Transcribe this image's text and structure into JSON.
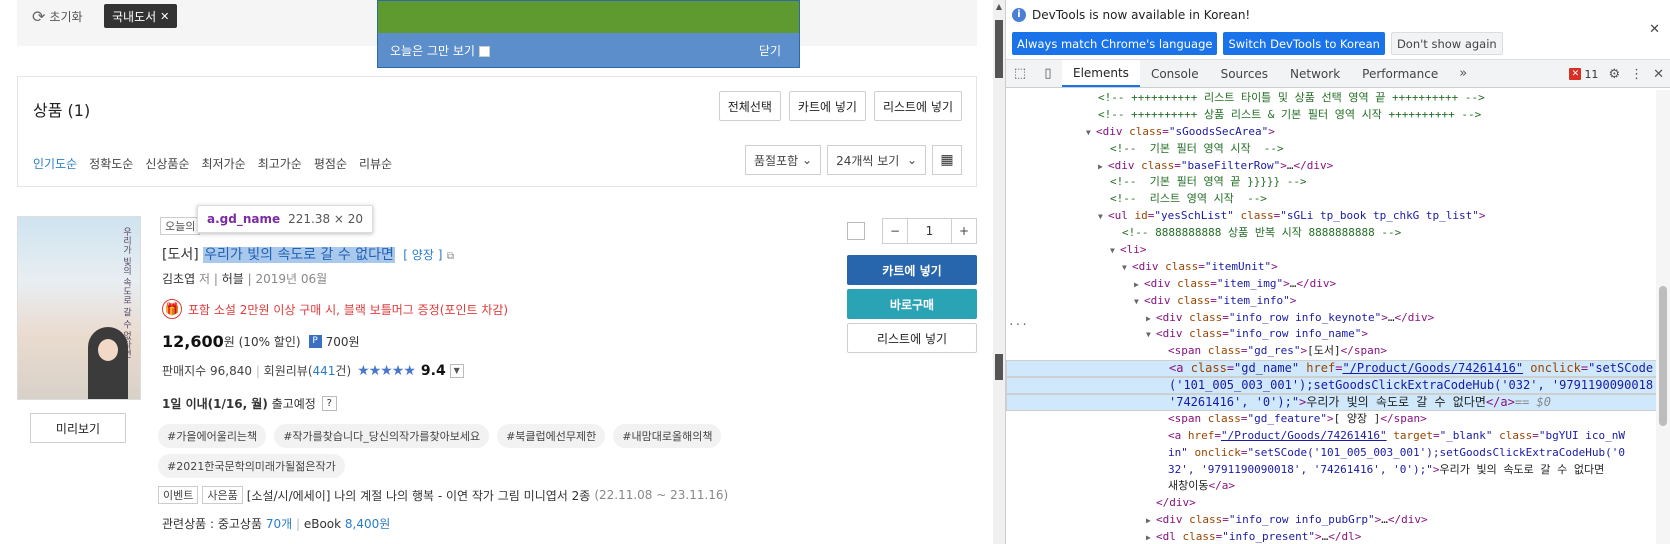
{
  "page": {
    "reset_label": "초기화",
    "filter_chip": "국내도서",
    "popup": {
      "dont_show_today": "오늘은 그만 보기",
      "close": "닫기"
    },
    "section_title": "상품 (1)",
    "top_buttons": [
      "전체선택",
      "카트에 넣기",
      "리스트에 넣기"
    ],
    "sorts": [
      "인기도순",
      "정확도순",
      "신상품순",
      "최저가순",
      "최고가순",
      "평점순",
      "리뷰순"
    ],
    "sort_active_index": 0,
    "filter_select": "품절포함",
    "perpage_select": "24개씩 보기",
    "tooltip": {
      "name": "a.gd_name",
      "dims": "221.38 × 20"
    },
    "keynote": "오늘의",
    "book": {
      "cover_text": "우리가 빛의 속도로 갈 수 없다면",
      "res": "[도서]",
      "title": "우리가 빛의 속도로 갈 수 없다면",
      "feature": "[ 양장 ]",
      "author": "김초엽",
      "author_suffix": "저",
      "publisher": "허블",
      "date": "2019년 06월",
      "gift": "포함 소설 2만원 이상 구매 시, 블랙 보틀머그 증정(포인트 차감)",
      "price": "12,600",
      "price_unit": "원",
      "discount": "(10% 할인)",
      "point": "700원",
      "sales_label": "판매지수",
      "sales": "96,840",
      "review_label": "회원리뷰(",
      "review_count": "441",
      "review_suffix": "건)",
      "stars": "★★★★★",
      "rating": "9.4",
      "ship_bold": "1일 이내(1/16, 월)",
      "ship_rest": "출고예정",
      "tags": [
        "#가을에어울리는책",
        "#작가를찾습니다_당신의작가를찾아보세요",
        "#북클럽에선무제한",
        "#내맘대로올해의책",
        "#2021한국문학의미래가될젊은작가"
      ],
      "event_badges": [
        "이벤트",
        "사은품"
      ],
      "event_text": "[소설/시/에세이] 나의 계절 나의 행복 - 이연 작가 그림 미니엽서 2종",
      "event_date": "(22.11.08 ~ 23.11.16)",
      "rel_label": "관련상품 : 중고상품",
      "rel_used": "70개",
      "rel_ebook_label": "eBook",
      "rel_ebook": "8,400원"
    },
    "qty": "1",
    "cart_btn": "카트에 넣기",
    "buy_btn": "바로구매",
    "list_btn": "리스트에 넣기",
    "preview_btn": "미리보기"
  },
  "devtools": {
    "info_msg": "DevTools is now available in Korean!",
    "info_buttons": [
      "Always match Chrome's language",
      "Switch DevTools to Korean",
      "Don't show again"
    ],
    "tabs": [
      "Elements",
      "Console",
      "Sources",
      "Network",
      "Performance"
    ],
    "active_tab": "Elements",
    "error_count": "11",
    "eq": "== $0"
  },
  "colors": {
    "accent": "#1a73e8",
    "cart": "#2766ad",
    "buy": "#2aa3b5",
    "price_red": "#e03a3a"
  }
}
